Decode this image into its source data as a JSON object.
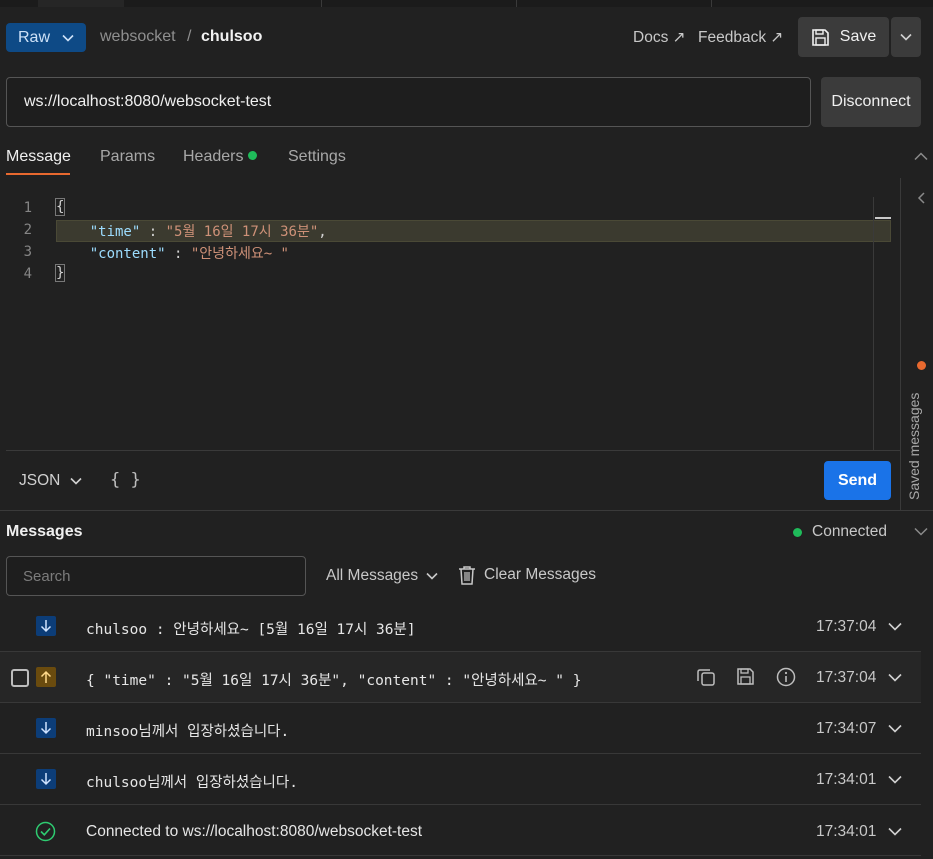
{
  "header": {
    "mode_label": "Raw",
    "breadcrumb_parent": "websocket",
    "breadcrumb_separator": "/",
    "breadcrumb_current": "chulsoo",
    "docs_label": "Docs ↗",
    "feedback_label": "Feedback ↗",
    "save_label": "Save"
  },
  "request": {
    "url": "ws://localhost:8080/websocket-test",
    "disconnect_label": "Disconnect"
  },
  "tabs": [
    {
      "label": "Message"
    },
    {
      "label": "Params"
    },
    {
      "label": "Headers"
    },
    {
      "label": "Settings"
    }
  ],
  "editor": {
    "line_numbers": [
      "1",
      "2",
      "3",
      "4"
    ],
    "line1": "{",
    "line2_key": "\"time\"",
    "line2_sep": " : ",
    "line2_value": "\"5월 16일 17시 36분\"",
    "line2_comma": ",",
    "line3_key": "\"content\"",
    "line3_sep": " : ",
    "line3_value": "\"안녕하세요~ \"",
    "line4": "}",
    "format_label": "JSON",
    "beautify_label": "{ }",
    "send_label": "Send",
    "saved_messages_label": "Saved messages"
  },
  "messages": {
    "title": "Messages",
    "status": "Connected",
    "search_placeholder": "Search",
    "filter_label": "All Messages",
    "clear_label": "Clear Messages",
    "items": [
      {
        "direction": "incoming",
        "text": "chulsoo : 안녕하세요~ [5월 16일 17시 36분]",
        "time": "17:37:04"
      },
      {
        "direction": "outgoing",
        "text": "{ \"time\" : \"5월 16일 17시 36분\", \"content\" : \"안녕하세요~ \" }",
        "time": "17:37:04"
      },
      {
        "direction": "incoming",
        "text": "minsoo님께서 입장하셨습니다.",
        "time": "17:34:07"
      },
      {
        "direction": "incoming",
        "text": "chulsoo님께서 입장하셨습니다.",
        "time": "17:34:01"
      },
      {
        "direction": "status",
        "text": "Connected to ws://localhost:8080/websocket-test",
        "time": "17:34:01"
      }
    ]
  },
  "colors": {
    "accent_orange": "#e8692f",
    "send_blue": "#1a73e8",
    "connected_green": "#1fbb5a",
    "raw_blue": "#0e4a86"
  }
}
